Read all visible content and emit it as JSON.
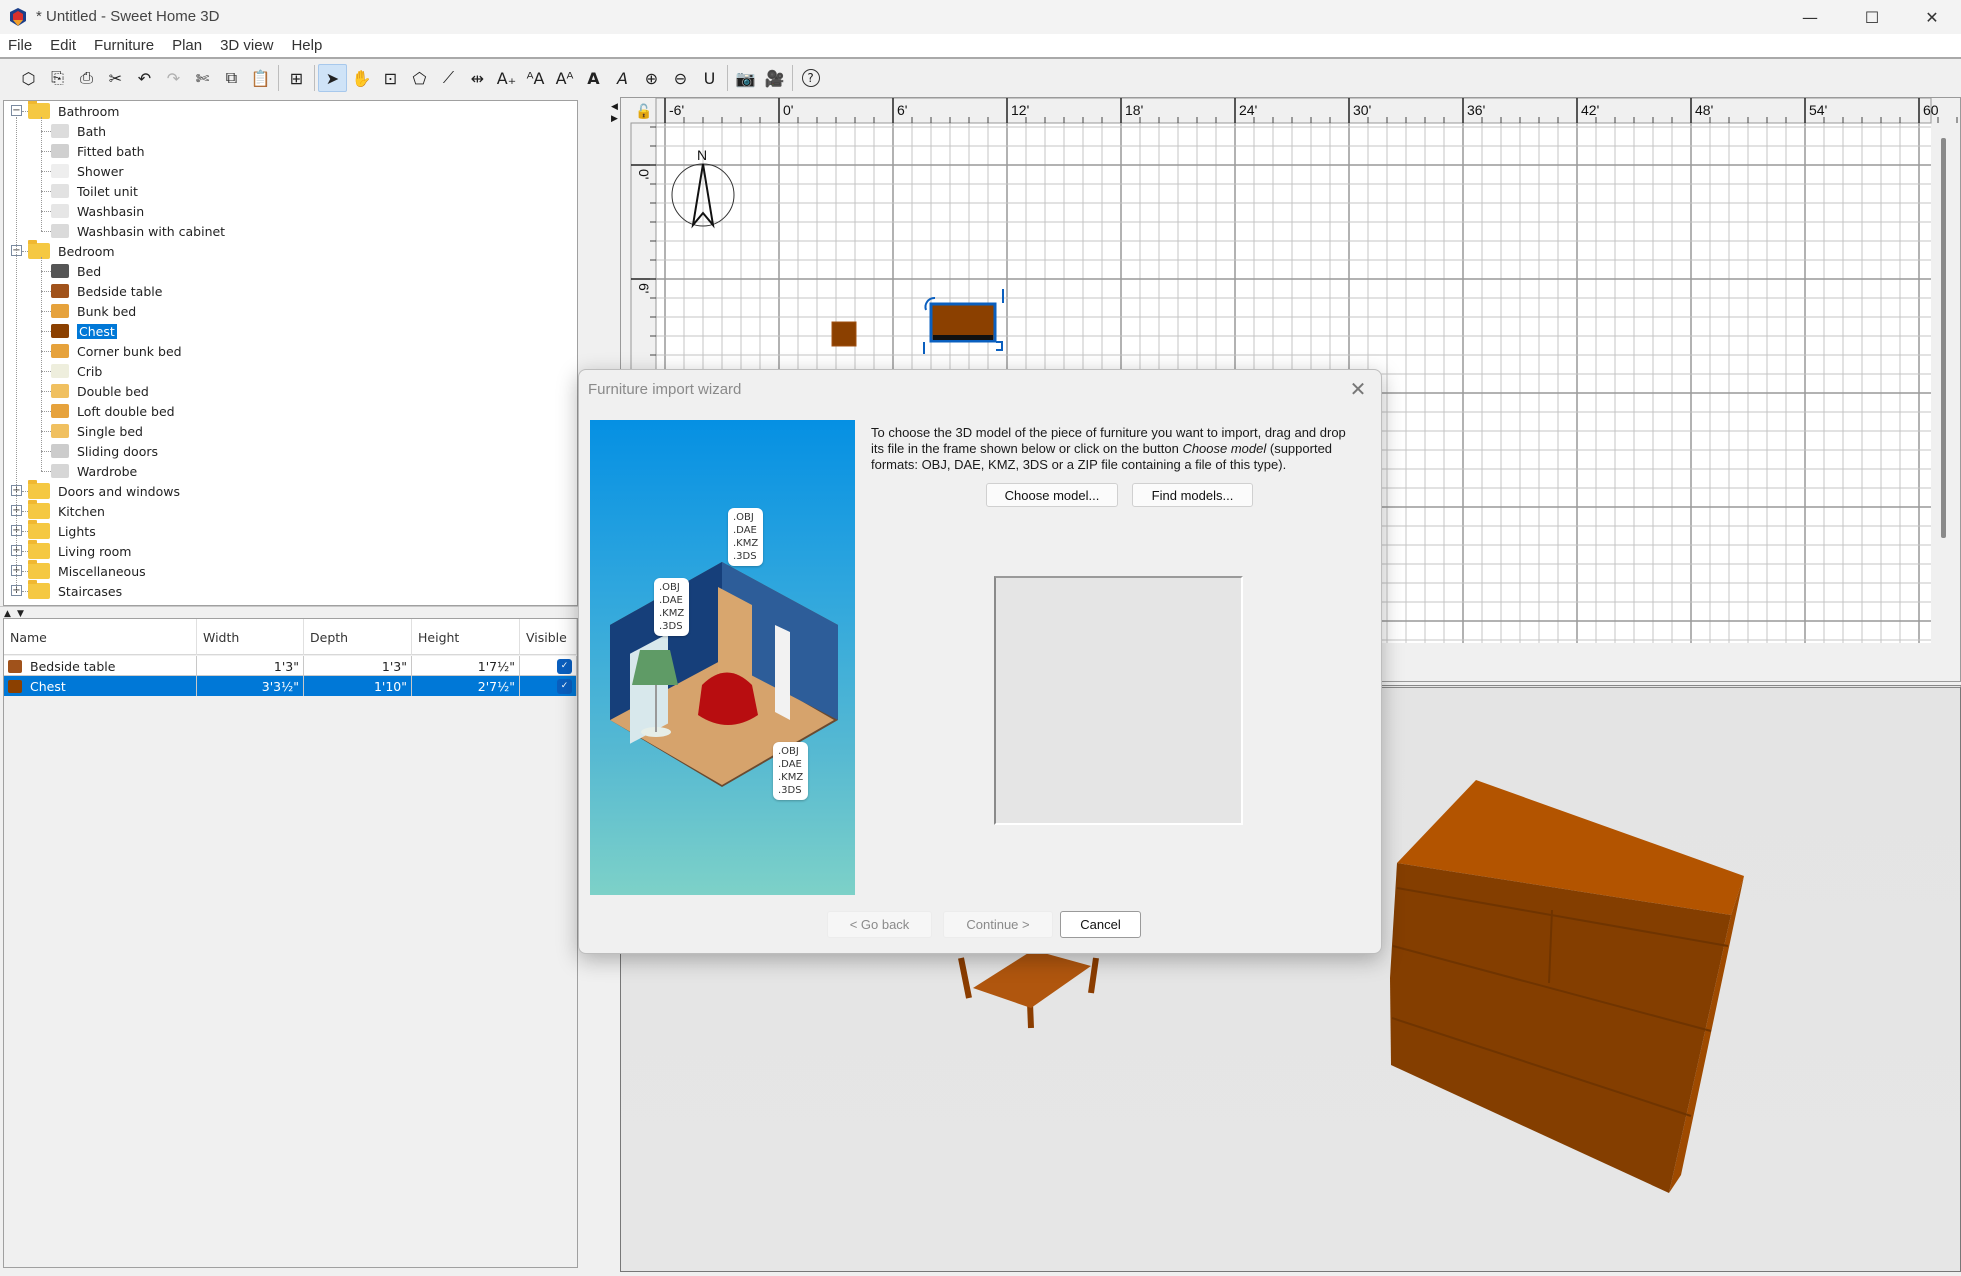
{
  "window": {
    "title": "* Untitled - Sweet Home 3D",
    "controls": {
      "minimize": "—",
      "maximize": "☐",
      "close": "✕"
    }
  },
  "menu": [
    "File",
    "Edit",
    "Furniture",
    "Plan",
    "3D view",
    "Help"
  ],
  "toolbar": {
    "buttons": [
      {
        "name": "new-home",
        "glyph": "⬡",
        "state": "normal"
      },
      {
        "name": "open",
        "glyph": "⎘",
        "state": "normal"
      },
      {
        "name": "save",
        "glyph": "⎙",
        "state": "normal"
      },
      {
        "name": "preferences",
        "glyph": "✂",
        "state": "normal"
      },
      {
        "name": "undo",
        "glyph": "↶",
        "state": "normal"
      },
      {
        "name": "redo",
        "glyph": "↷",
        "state": "disabled"
      },
      {
        "name": "cut",
        "glyph": "✄",
        "state": "normal"
      },
      {
        "name": "copy",
        "glyph": "⧉",
        "state": "normal"
      },
      {
        "name": "paste",
        "glyph": "📋",
        "state": "disabled"
      },
      {
        "name": "add-furniture",
        "glyph": "⊞",
        "state": "normal"
      },
      {
        "name": "select-mode",
        "glyph": "➤",
        "state": "active"
      },
      {
        "name": "pan-mode",
        "glyph": "✋",
        "state": "normal"
      },
      {
        "name": "create-walls",
        "glyph": "⊡",
        "state": "normal"
      },
      {
        "name": "create-rooms",
        "glyph": "⬠",
        "state": "normal"
      },
      {
        "name": "create-polylines",
        "glyph": "⟋",
        "state": "normal"
      },
      {
        "name": "create-dimensions",
        "glyph": "⇹",
        "state": "normal"
      },
      {
        "name": "add-text",
        "glyph": "A₊",
        "state": "normal"
      },
      {
        "name": "increase-text-size",
        "glyph": "ᴬA",
        "state": "normal"
      },
      {
        "name": "decrease-text-size",
        "glyph": "Aᴬ",
        "state": "normal"
      },
      {
        "name": "bold-text",
        "glyph": "A",
        "state": "normal"
      },
      {
        "name": "italic-text",
        "glyph": "A",
        "state": "normal"
      },
      {
        "name": "zoom-in",
        "glyph": "⊕",
        "state": "normal"
      },
      {
        "name": "zoom-out",
        "glyph": "⊖",
        "state": "normal"
      },
      {
        "name": "magnetism",
        "glyph": "U",
        "state": "normal"
      },
      {
        "name": "create-photo",
        "glyph": "📷",
        "state": "normal"
      },
      {
        "name": "create-video",
        "glyph": "🎥",
        "state": "normal"
      },
      {
        "name": "help",
        "glyph": "?",
        "state": "normal"
      }
    ]
  },
  "catalog": {
    "categories": [
      {
        "label": "Bathroom",
        "expanded": true,
        "items": [
          "Bath",
          "Fitted bath",
          "Shower",
          "Toilet unit",
          "Washbasin",
          "Washbasin with cabinet"
        ]
      },
      {
        "label": "Bedroom",
        "expanded": true,
        "items": [
          "Bed",
          "Bedside table",
          "Bunk bed",
          "Chest",
          "Corner bunk bed",
          "Crib",
          "Double bed",
          "Loft double bed",
          "Single bed",
          "Sliding doors",
          "Wardrobe"
        ]
      },
      {
        "label": "Doors and windows",
        "expanded": false,
        "items": []
      },
      {
        "label": "Kitchen",
        "expanded": false,
        "items": []
      },
      {
        "label": "Lights",
        "expanded": false,
        "items": []
      },
      {
        "label": "Living room",
        "expanded": false,
        "items": []
      },
      {
        "label": "Miscellaneous",
        "expanded": false,
        "items": []
      },
      {
        "label": "Staircases",
        "expanded": false,
        "items": []
      }
    ],
    "selected_item": "Chest"
  },
  "furniture_table": {
    "columns": [
      "Name",
      "Width",
      "Depth",
      "Height",
      "Visible"
    ],
    "rows": [
      {
        "name": "Bedside table",
        "width": "1'3\"",
        "depth": "1'3\"",
        "height": "1'7½\"",
        "visible": true,
        "selected": false
      },
      {
        "name": "Chest",
        "width": "3'3½\"",
        "depth": "1'10\"",
        "height": "2'7½\"",
        "visible": true,
        "selected": true
      }
    ]
  },
  "plan": {
    "x_ruler": [
      "-6'",
      "0'",
      "6'",
      "12'",
      "18'",
      "24'",
      "30'",
      "36'",
      "42'",
      "48'",
      "54'",
      "60"
    ],
    "y_ruler": [
      "0'",
      "6'"
    ],
    "compass_label": "N"
  },
  "dialog": {
    "title": "Furniture import wizard",
    "close": "✕",
    "instruction_pre": "To choose the 3D model of the piece of furniture you want to import, drag and drop its file in the frame shown below or click on the button ",
    "instruction_em": "Choose model",
    "instruction_post": " (supported formats: OBJ, DAE, KMZ, 3DS or a ZIP file containing a file of this type).",
    "choose_model": "Choose model...",
    "find_models": "Find models...",
    "go_back": "< Go back",
    "continue": "Continue >",
    "cancel": "Cancel",
    "format_bubble": ".OBJ\n.DAE\n.KMZ\n.3DS"
  },
  "colors": {
    "selection": "#0078d7",
    "furniture_brown": "#8b4000",
    "chest_3d": "#b35400"
  }
}
